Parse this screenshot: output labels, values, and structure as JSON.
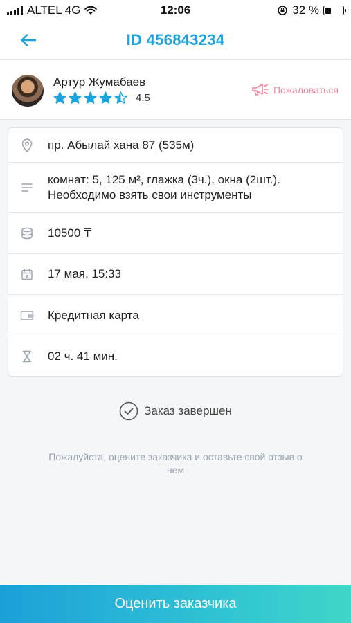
{
  "status_bar": {
    "carrier": "ALTEL 4G",
    "time": "12:06",
    "battery_text": "32 %",
    "battery_level": 0.32
  },
  "header": {
    "title": "ID 456843234",
    "back_icon": "arrow-left-icon"
  },
  "customer": {
    "name": "Артур Жумабаев",
    "rating": "4.5",
    "rating_value": 4.5,
    "complain_label": "Пожаловаться"
  },
  "details": [
    {
      "icon": "location-pin-icon",
      "text": "пр. Абылай хана 87 (535м)"
    },
    {
      "icon": "description-lines-icon",
      "text": "комнат: 5, 125 м², глажка (3ч.), окна (2шт.). Необходимо взять свои инструменты"
    },
    {
      "icon": "coins-icon",
      "text": "10500 ₸"
    },
    {
      "icon": "calendar-icon",
      "text": "17 мая, 15:33"
    },
    {
      "icon": "wallet-card-icon",
      "text": "Кредитная карта"
    },
    {
      "icon": "hourglass-icon",
      "text": "02 ч. 41 мин."
    }
  ],
  "order_status": "Заказ завершен",
  "hint": "Пожалуйста, оцените заказчика и оставьте свой отзыв о нем",
  "rate_button": "Оценить заказчика",
  "colors": {
    "accent": "#1aa3dc",
    "complain": "#f3849a",
    "star": "#1aa3dc"
  }
}
